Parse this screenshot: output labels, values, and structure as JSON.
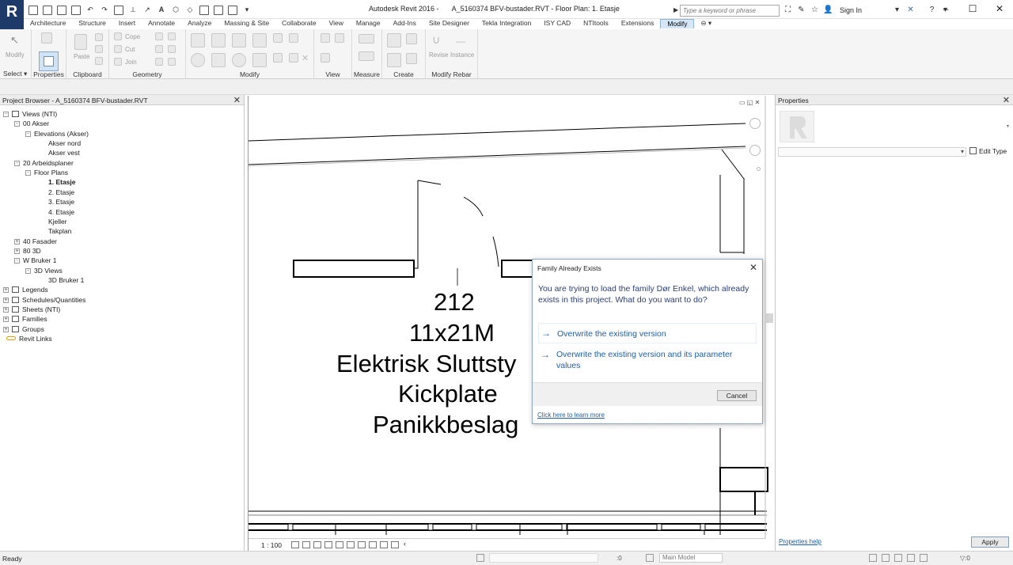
{
  "window": {
    "app_name": "Autodesk Revit 2016 -",
    "file_name": "A_5160374 BFV-bustader.RVT - Floor Plan: 1. Etasje",
    "search_placeholder": "Type a keyword or phrase",
    "sign_in": "Sign In",
    "controls": [
      "–",
      "☐",
      "✕"
    ]
  },
  "ribbon": {
    "tabs": [
      "Architecture",
      "Structure",
      "Insert",
      "Annotate",
      "Analyze",
      "Massing & Site",
      "Collaborate",
      "View",
      "Manage",
      "Add-Ins",
      "Site Designer",
      "Tekla Integration",
      "ISY CAD",
      "NTItools",
      "Extensions",
      "Modify"
    ],
    "active_tab": "Modify",
    "groups": {
      "select": "Select",
      "properties": "Properties",
      "clipboard": "Clipboard",
      "geometry": "Geometry",
      "modify": "Modify",
      "view": "View",
      "measure": "Measure",
      "create": "Create",
      "modify_rebar": "Modify Rebar"
    },
    "buttons": {
      "modify": "Modify",
      "paste": "Paste",
      "cope": "Cope",
      "cut": "Cut",
      "join": "Join",
      "revise": "Revise",
      "instance": "Instance"
    }
  },
  "project_browser": {
    "title": "Project Browser - A_5160374 BFV-bustader.RVT",
    "tree": [
      {
        "label": "Views (NTI)",
        "level": 0,
        "toggle": "-",
        "icon": true
      },
      {
        "label": "00 Akser",
        "level": 1,
        "toggle": "-"
      },
      {
        "label": "Elevations (Akser)",
        "level": 2,
        "toggle": "-"
      },
      {
        "label": "Akser nord",
        "level": 3
      },
      {
        "label": "Akser vest",
        "level": 3
      },
      {
        "label": "20 Arbeidsplaner",
        "level": 1,
        "toggle": "-"
      },
      {
        "label": "Floor Plans",
        "level": 2,
        "toggle": "-"
      },
      {
        "label": "1. Etasje",
        "level": 3,
        "bold": true
      },
      {
        "label": "2. Etasje",
        "level": 3
      },
      {
        "label": "3. Etasje",
        "level": 3
      },
      {
        "label": "4. Etasje",
        "level": 3
      },
      {
        "label": "Kjeller",
        "level": 3
      },
      {
        "label": "Takplan",
        "level": 3
      },
      {
        "label": "40 Fasader",
        "level": 1,
        "toggle": "+"
      },
      {
        "label": "80 3D",
        "level": 1,
        "toggle": "+"
      },
      {
        "label": "W Bruker 1",
        "level": 1,
        "toggle": "-"
      },
      {
        "label": "3D Views",
        "level": 2,
        "toggle": "-"
      },
      {
        "label": "3D Bruker 1",
        "level": 3
      },
      {
        "label": "Legends",
        "level": 0,
        "toggle": "+",
        "icon": true
      },
      {
        "label": "Schedules/Quantities",
        "level": 0,
        "toggle": "+",
        "icon": true
      },
      {
        "label": "Sheets (NTI)",
        "level": 0,
        "toggle": "+",
        "icon": true
      },
      {
        "label": "Families",
        "level": 0,
        "toggle": "+",
        "icon": true
      },
      {
        "label": "Groups",
        "level": 0,
        "toggle": "+",
        "icon": true
      },
      {
        "label": "Revit Links",
        "level": 0,
        "link": true
      }
    ]
  },
  "drawing": {
    "door_tag": [
      "212",
      "11x21M",
      "Elektrisk Sluttsty",
      "Kickplate",
      "Panikkbeslag"
    ],
    "scale": "1 : 100"
  },
  "dialog": {
    "title": "Family Already Exists",
    "message": "You are trying to load the family Dør Enkel, which already exists in this project.  What do you want to do?",
    "option_1": "Overwrite the existing version",
    "option_2": "Overwrite the existing version and its parameter values",
    "cancel": "Cancel",
    "learn_more": "Click here to learn more"
  },
  "properties": {
    "title": "Properties",
    "edit_type": "Edit Type",
    "help": "Properties help",
    "apply": "Apply"
  },
  "status": {
    "text": "Ready",
    "workset": "Main Model",
    "count": ":0",
    "filter": "▽:0"
  }
}
